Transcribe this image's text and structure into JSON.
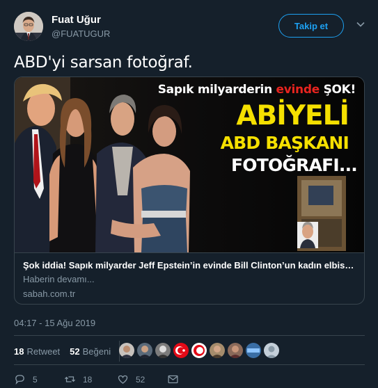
{
  "author": {
    "display_name": "Fuat Uğur",
    "handle": "@FUATUGUR"
  },
  "follow_button": "Takip et",
  "tweet_text": "ABD'yi sarsan fotoğraf.",
  "card": {
    "image": {
      "headline_prefix": "Sapık milyarderin ",
      "headline_highlight": "evinde",
      "headline_suffix": " ŞOK!",
      "big_line1": "ABİYELİ",
      "big_line2": "ABD BAŞKANI",
      "big_line3": "FOTOĞRAFI..."
    },
    "title": "Şok iddia! Sapık milyarder Jeff Epstein’in evinde Bill Clinton’un kadın elbisesi giydiği fotoğraf",
    "description": "Haberin devamı...",
    "domain": "sabah.com.tr"
  },
  "timestamp": "04:17 - 15 Ağu 2019",
  "stats": {
    "retweets_count": "18",
    "retweets_label": "Retweet",
    "likes_count": "52",
    "likes_label": "Beğeni"
  },
  "actions": {
    "reply_count": "5",
    "retweet_count": "18",
    "like_count": "52"
  },
  "colors": {
    "background": "#15202b",
    "accent": "#1da1f2",
    "muted_text": "#8899a6",
    "border": "#38444d",
    "headline_yellow": "#f5e000",
    "headline_red": "#e8241f"
  },
  "icons": [
    "caret-down-icon",
    "reply-icon",
    "retweet-icon",
    "like-icon",
    "message-icon"
  ]
}
